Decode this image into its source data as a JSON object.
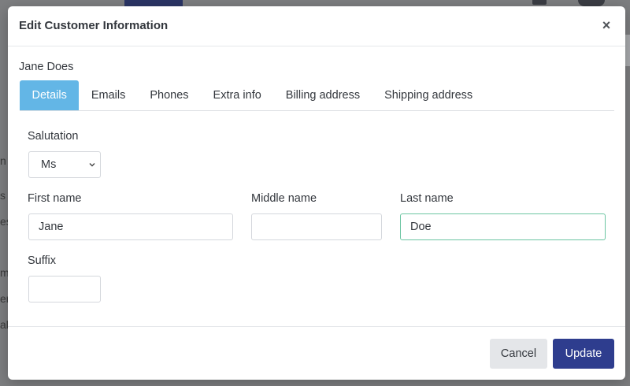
{
  "modal": {
    "title": "Edit Customer Information",
    "close_symbol": "×",
    "customer_name": "Jane Does"
  },
  "tabs": [
    {
      "label": "Details",
      "active": true
    },
    {
      "label": "Emails",
      "active": false
    },
    {
      "label": "Phones",
      "active": false
    },
    {
      "label": "Extra info",
      "active": false
    },
    {
      "label": "Billing address",
      "active": false
    },
    {
      "label": "Shipping address",
      "active": false
    }
  ],
  "form": {
    "salutation": {
      "label": "Salutation",
      "value": "Ms"
    },
    "first_name": {
      "label": "First name",
      "value": "Jane"
    },
    "middle_name": {
      "label": "Middle name",
      "value": ""
    },
    "last_name": {
      "label": "Last name",
      "value": "Doe"
    },
    "suffix": {
      "label": "Suffix",
      "value": ""
    }
  },
  "footer": {
    "cancel_label": "Cancel",
    "update_label": "Update"
  },
  "background": {
    "peek_fragments": [
      "n",
      "s",
      "es",
      "m",
      "er",
      "al"
    ]
  },
  "colors": {
    "active_tab": "#63b6e6",
    "primary_button": "#2e3d8e",
    "focus_border": "#6cc5a2",
    "backdrop": "#7d7e80"
  },
  "icons": {
    "close": "close-icon",
    "select_arrow": "chevron-down-icon"
  }
}
